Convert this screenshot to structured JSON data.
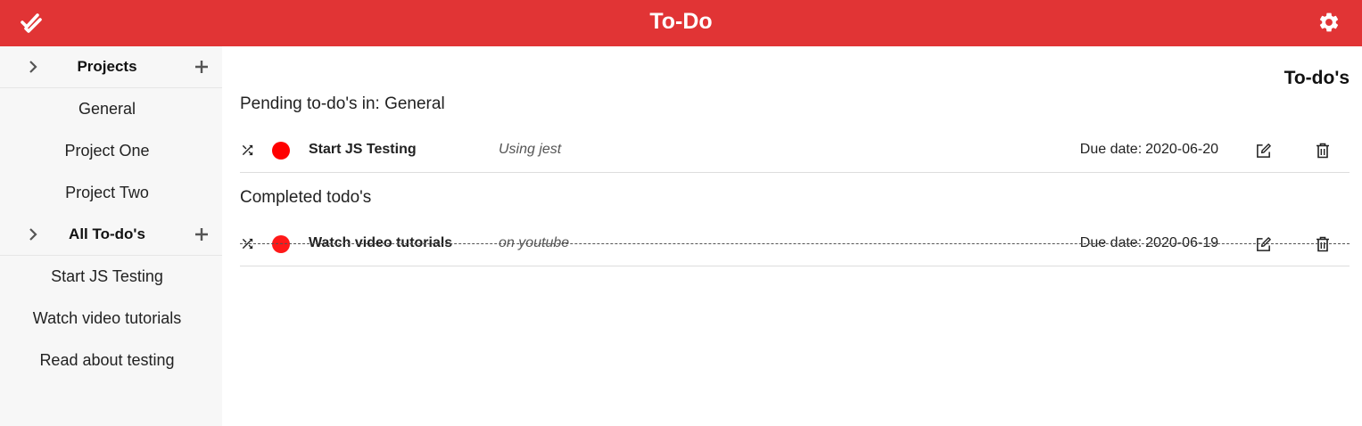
{
  "app": {
    "title": "To-Do",
    "logo_icon": "double-check-icon",
    "settings_icon": "gear-icon",
    "brand_color": "#e13435"
  },
  "sidebar": {
    "projects": {
      "label": "Projects",
      "items": [
        "General",
        "Project One",
        "Project Two"
      ]
    },
    "todos": {
      "label": "All To-do's",
      "items": [
        "Start JS Testing",
        "Watch video tutorials",
        "Read about testing"
      ]
    }
  },
  "main": {
    "view_title": "To-do's",
    "pending_title": "Pending to-do's in: General",
    "completed_title": "Completed todo's",
    "due_label": "Due date:",
    "pending": [
      {
        "name": "Start JS Testing",
        "description": "Using jest",
        "due": "2020-06-20",
        "priority_color": "#ff0000"
      }
    ],
    "completed": [
      {
        "name": "Watch video tutorials",
        "description": "on youtube",
        "due": "2020-06-19",
        "priority_color": "#ff0000"
      }
    ]
  }
}
